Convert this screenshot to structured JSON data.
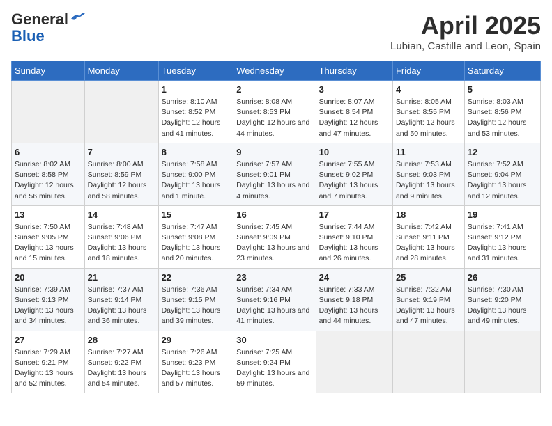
{
  "header": {
    "logo_general": "General",
    "logo_blue": "Blue",
    "month_title": "April 2025",
    "location": "Lubian, Castille and Leon, Spain"
  },
  "columns": [
    "Sunday",
    "Monday",
    "Tuesday",
    "Wednesday",
    "Thursday",
    "Friday",
    "Saturday"
  ],
  "weeks": [
    [
      {
        "day": "",
        "info": ""
      },
      {
        "day": "",
        "info": ""
      },
      {
        "day": "1",
        "info": "Sunrise: 8:10 AM\nSunset: 8:52 PM\nDaylight: 12 hours and 41 minutes."
      },
      {
        "day": "2",
        "info": "Sunrise: 8:08 AM\nSunset: 8:53 PM\nDaylight: 12 hours and 44 minutes."
      },
      {
        "day": "3",
        "info": "Sunrise: 8:07 AM\nSunset: 8:54 PM\nDaylight: 12 hours and 47 minutes."
      },
      {
        "day": "4",
        "info": "Sunrise: 8:05 AM\nSunset: 8:55 PM\nDaylight: 12 hours and 50 minutes."
      },
      {
        "day": "5",
        "info": "Sunrise: 8:03 AM\nSunset: 8:56 PM\nDaylight: 12 hours and 53 minutes."
      }
    ],
    [
      {
        "day": "6",
        "info": "Sunrise: 8:02 AM\nSunset: 8:58 PM\nDaylight: 12 hours and 56 minutes."
      },
      {
        "day": "7",
        "info": "Sunrise: 8:00 AM\nSunset: 8:59 PM\nDaylight: 12 hours and 58 minutes."
      },
      {
        "day": "8",
        "info": "Sunrise: 7:58 AM\nSunset: 9:00 PM\nDaylight: 13 hours and 1 minute."
      },
      {
        "day": "9",
        "info": "Sunrise: 7:57 AM\nSunset: 9:01 PM\nDaylight: 13 hours and 4 minutes."
      },
      {
        "day": "10",
        "info": "Sunrise: 7:55 AM\nSunset: 9:02 PM\nDaylight: 13 hours and 7 minutes."
      },
      {
        "day": "11",
        "info": "Sunrise: 7:53 AM\nSunset: 9:03 PM\nDaylight: 13 hours and 9 minutes."
      },
      {
        "day": "12",
        "info": "Sunrise: 7:52 AM\nSunset: 9:04 PM\nDaylight: 13 hours and 12 minutes."
      }
    ],
    [
      {
        "day": "13",
        "info": "Sunrise: 7:50 AM\nSunset: 9:05 PM\nDaylight: 13 hours and 15 minutes."
      },
      {
        "day": "14",
        "info": "Sunrise: 7:48 AM\nSunset: 9:06 PM\nDaylight: 13 hours and 18 minutes."
      },
      {
        "day": "15",
        "info": "Sunrise: 7:47 AM\nSunset: 9:08 PM\nDaylight: 13 hours and 20 minutes."
      },
      {
        "day": "16",
        "info": "Sunrise: 7:45 AM\nSunset: 9:09 PM\nDaylight: 13 hours and 23 minutes."
      },
      {
        "day": "17",
        "info": "Sunrise: 7:44 AM\nSunset: 9:10 PM\nDaylight: 13 hours and 26 minutes."
      },
      {
        "day": "18",
        "info": "Sunrise: 7:42 AM\nSunset: 9:11 PM\nDaylight: 13 hours and 28 minutes."
      },
      {
        "day": "19",
        "info": "Sunrise: 7:41 AM\nSunset: 9:12 PM\nDaylight: 13 hours and 31 minutes."
      }
    ],
    [
      {
        "day": "20",
        "info": "Sunrise: 7:39 AM\nSunset: 9:13 PM\nDaylight: 13 hours and 34 minutes."
      },
      {
        "day": "21",
        "info": "Sunrise: 7:37 AM\nSunset: 9:14 PM\nDaylight: 13 hours and 36 minutes."
      },
      {
        "day": "22",
        "info": "Sunrise: 7:36 AM\nSunset: 9:15 PM\nDaylight: 13 hours and 39 minutes."
      },
      {
        "day": "23",
        "info": "Sunrise: 7:34 AM\nSunset: 9:16 PM\nDaylight: 13 hours and 41 minutes."
      },
      {
        "day": "24",
        "info": "Sunrise: 7:33 AM\nSunset: 9:18 PM\nDaylight: 13 hours and 44 minutes."
      },
      {
        "day": "25",
        "info": "Sunrise: 7:32 AM\nSunset: 9:19 PM\nDaylight: 13 hours and 47 minutes."
      },
      {
        "day": "26",
        "info": "Sunrise: 7:30 AM\nSunset: 9:20 PM\nDaylight: 13 hours and 49 minutes."
      }
    ],
    [
      {
        "day": "27",
        "info": "Sunrise: 7:29 AM\nSunset: 9:21 PM\nDaylight: 13 hours and 52 minutes."
      },
      {
        "day": "28",
        "info": "Sunrise: 7:27 AM\nSunset: 9:22 PM\nDaylight: 13 hours and 54 minutes."
      },
      {
        "day": "29",
        "info": "Sunrise: 7:26 AM\nSunset: 9:23 PM\nDaylight: 13 hours and 57 minutes."
      },
      {
        "day": "30",
        "info": "Sunrise: 7:25 AM\nSunset: 9:24 PM\nDaylight: 13 hours and 59 minutes."
      },
      {
        "day": "",
        "info": ""
      },
      {
        "day": "",
        "info": ""
      },
      {
        "day": "",
        "info": ""
      }
    ]
  ]
}
